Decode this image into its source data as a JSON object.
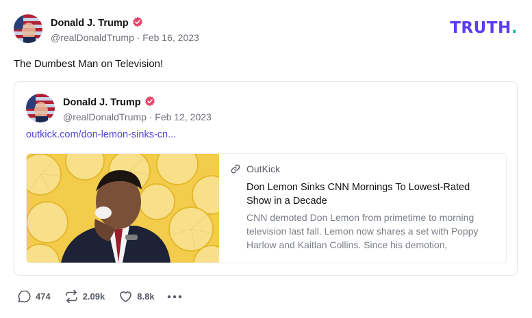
{
  "post": {
    "author_name": "Donald J. Trump",
    "author_handle": "@realDonaldTrump",
    "date": "Feb 16, 2023",
    "handle_line": "@realDonaldTrump · Feb 16, 2023",
    "text": "The Dumbest Man on Television!"
  },
  "brand": {
    "logo_text": "TRUTH",
    "logo_dot": ".",
    "accent_color": "#5b3df5",
    "dot_color": "#16c5a8"
  },
  "quote": {
    "author_name": "Donald J. Trump",
    "handle_line": "@realDonaldTrump · Feb 12, 2023",
    "link_text": "outkick.com/don-lemon-sinks-cn...",
    "preview": {
      "source": "OutKick",
      "title": "Don Lemon Sinks CNN Mornings To Lowest-Rated Show in a Decade",
      "description": "CNN demoted Don Lemon from primetime to morning television last fall. Lemon now shares a set with Poppy Harlow and Kaitlan Collins. Since his demotion,"
    }
  },
  "actions": {
    "replies": "474",
    "retruths": "2.09k",
    "likes": "8.8k"
  },
  "icons": {
    "verified": "verified-badge-icon",
    "reply": "speech-bubble-icon",
    "retruth": "repost-arrows-icon",
    "like": "heart-icon",
    "more": "ellipsis-icon",
    "link": "chain-link-icon"
  }
}
